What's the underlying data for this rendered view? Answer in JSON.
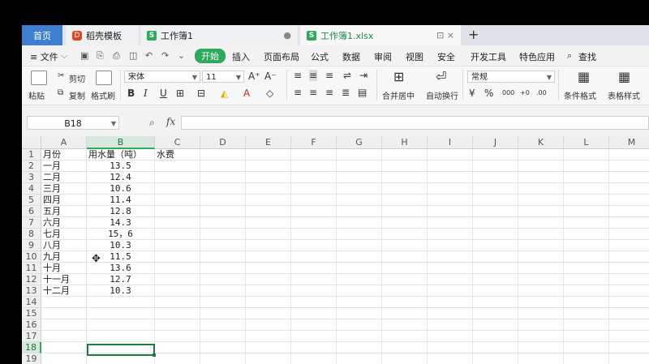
{
  "tabs": {
    "home": "首页",
    "template": "稻壳模板",
    "book1": "工作簿1",
    "book1_close": "●",
    "book1_xlsx": "工作簿1.xlsx",
    "xlsx_extra": "⊡ ×",
    "new_tab": "+"
  },
  "menu": {
    "file": "≡ 文件",
    "items": [
      "开始",
      "插入",
      "页面布局",
      "公式",
      "数据",
      "审阅",
      "视图",
      "安全",
      "开发工具",
      "特色应用"
    ],
    "search": "查找"
  },
  "ribbon": {
    "paste": "粘贴",
    "cut": "剪切",
    "copy": "复制",
    "format_painter": "格式刷",
    "font_name": "宋体",
    "font_size": "11",
    "grow": "A⁺",
    "shrink": "A⁻",
    "bold": "B",
    "italic": "I",
    "underline": "U",
    "merge_center": "合并居中",
    "wrap_text": "自动换行",
    "number_format": "常规",
    "percent": "%",
    "thousands": "000",
    "conditional_format": "条件格式",
    "table_style": "表格样式"
  },
  "formula_bar": {
    "name_box": "B18",
    "fx": "fx",
    "formula": ""
  },
  "columns": [
    "A",
    "B",
    "C",
    "D",
    "E",
    "F",
    "G",
    "H",
    "I",
    "J",
    "K",
    "L",
    "M"
  ],
  "selected_column": "B",
  "rows": [
    "1",
    "2",
    "3",
    "4",
    "5",
    "6",
    "7",
    "8",
    "9",
    "10",
    "11",
    "12",
    "13",
    "14",
    "15",
    "16",
    "17",
    "18",
    "19"
  ],
  "selected_row": "18",
  "sheet": {
    "header": [
      "月份",
      "用水量（吨）",
      "水费"
    ],
    "data": [
      [
        "一月",
        "13.5"
      ],
      [
        "二月",
        "12.4"
      ],
      [
        "三月",
        "10.6"
      ],
      [
        "四月",
        "11.4"
      ],
      [
        "五月",
        "12.8"
      ],
      [
        "六月",
        "14.3"
      ],
      [
        "七月",
        "15，6"
      ],
      [
        "八月",
        "10.3"
      ],
      [
        "九月",
        "11.5"
      ],
      [
        "十月",
        "13.6"
      ],
      [
        "十一月",
        "12.7"
      ],
      [
        "十二月",
        "10.3"
      ]
    ]
  },
  "colors": {
    "accent_green": "#2eaa5c",
    "home_tab_blue": "#3f7fd2"
  }
}
